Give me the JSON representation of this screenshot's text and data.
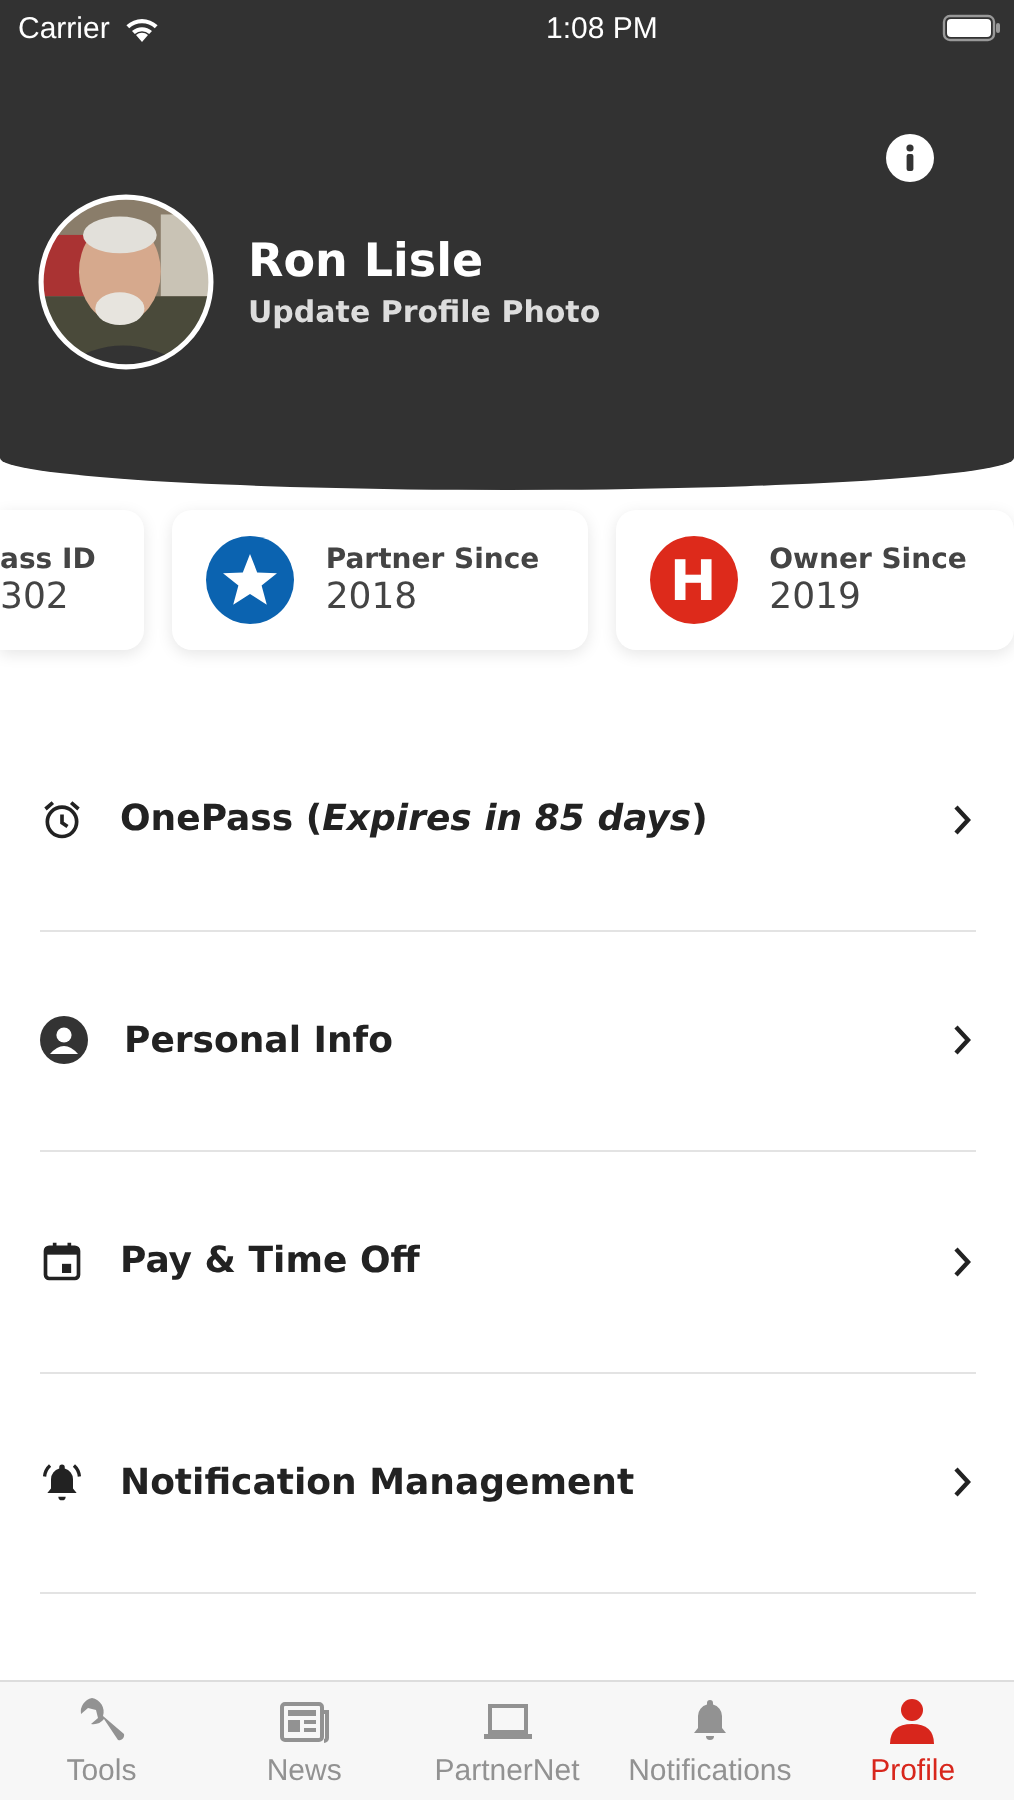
{
  "status_bar": {
    "carrier": "Carrier",
    "time": "1:08 PM"
  },
  "profile": {
    "name": "Ron Lisle",
    "action": "Update Profile Photo"
  },
  "cards": [
    {
      "kind": "cut",
      "label": "ass ID",
      "value": "302"
    },
    {
      "kind": "star",
      "label": "Partner Since",
      "value": "2018",
      "color": "#0b63b0"
    },
    {
      "kind": "letter",
      "label": "Owner Since",
      "value": "2019",
      "color": "#dd2a1b",
      "glyph": "H"
    }
  ],
  "menu": [
    {
      "kind": "alarm",
      "label": "OnePass (*Expires in 85 days*)"
    },
    {
      "kind": "person",
      "label": "Personal Info"
    },
    {
      "kind": "calendar",
      "label": "Pay & Time Off"
    },
    {
      "kind": "bell",
      "label": "Notification Management"
    }
  ],
  "tabs": [
    {
      "kind": "wrench",
      "label": "Tools",
      "selected": false
    },
    {
      "kind": "news",
      "label": "News",
      "selected": false
    },
    {
      "kind": "laptop",
      "label": "PartnerNet",
      "selected": false
    },
    {
      "kind": "bell",
      "label": "Notifications",
      "selected": false
    },
    {
      "kind": "person",
      "label": "Profile",
      "selected": true
    }
  ]
}
